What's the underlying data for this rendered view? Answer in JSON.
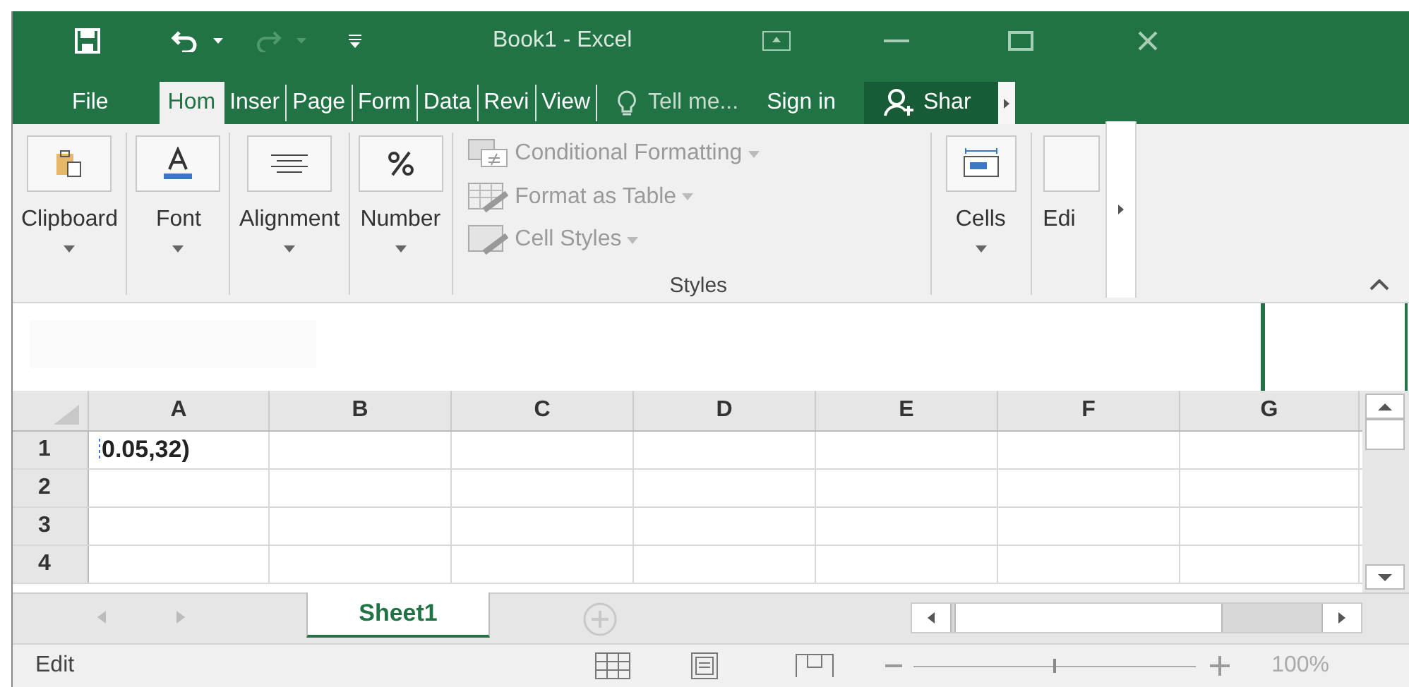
{
  "title_bar": {
    "title": "Book1 - Excel"
  },
  "tabs": [
    {
      "label": "File",
      "selected": false
    },
    {
      "label": "Hom",
      "selected": true
    },
    {
      "label": "Inser",
      "selected": false
    },
    {
      "label": "Page",
      "selected": false
    },
    {
      "label": "Form",
      "selected": false
    },
    {
      "label": "Data",
      "selected": false
    },
    {
      "label": "Revi",
      "selected": false
    },
    {
      "label": "View",
      "selected": false
    }
  ],
  "tell_me": "Tell me...",
  "sign_in": "Sign in",
  "share": "Shar",
  "ribbon": {
    "groups": [
      {
        "label": "Clipboard",
        "kind": "clipboard"
      },
      {
        "label": "Font",
        "kind": "font"
      },
      {
        "label": "Alignment",
        "kind": "alignment"
      },
      {
        "label": "Number",
        "kind": "number"
      }
    ],
    "styles": {
      "items": [
        {
          "label": "Conditional Formatting",
          "kind": "conditional"
        },
        {
          "label": "Format as Table",
          "kind": "table"
        },
        {
          "label": "Cell Styles",
          "kind": "styles"
        }
      ],
      "label": "Styles"
    },
    "cells": "Cells",
    "editing": "Edi"
  },
  "sheet": {
    "columns": [
      "A",
      "B",
      "C",
      "D",
      "E",
      "F",
      "G"
    ],
    "rows": [
      {
        "header": "1",
        "cells": [
          "0.05,32)"
        ]
      },
      {
        "header": "2",
        "cells": []
      },
      {
        "header": "3",
        "cells": []
      },
      {
        "header": "4",
        "cells": []
      }
    ]
  },
  "sheet_tabs": [
    {
      "label": "Sheet1",
      "selected": true
    }
  ],
  "status_bar": {
    "mode": "Edit",
    "zoom": "100%",
    "level": 0.5
  }
}
